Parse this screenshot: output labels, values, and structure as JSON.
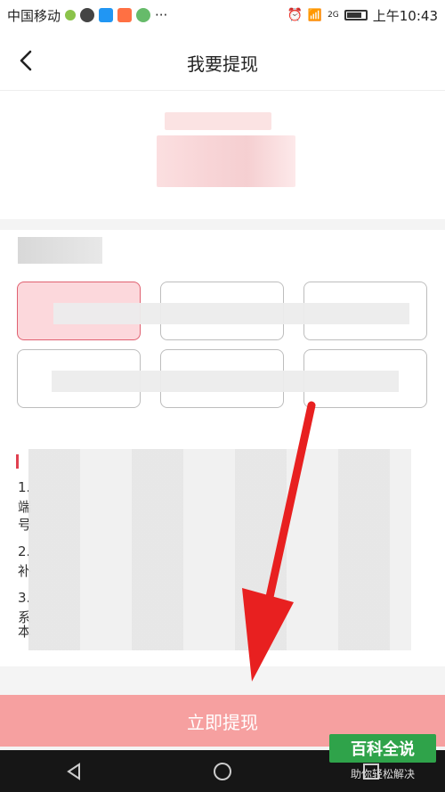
{
  "status_bar": {
    "carrier": "中国移动",
    "more": "···",
    "network": "2G",
    "time": "上午10:43"
  },
  "nav": {
    "title": "我要提现"
  },
  "amount_options": [
    "",
    "",
    "",
    "",
    "",
    ""
  ],
  "notes": {
    "lines": [
      "1.",
      "端",
      "号",
      "2.",
      "补",
      "3.",
      "系",
      "本"
    ]
  },
  "submit": {
    "label": "立即提现"
  },
  "watermark": {
    "title": "百科全说",
    "subtitle": "助你轻松解决"
  },
  "colors": {
    "submit_bg": "#f6a0a0",
    "selected_option": "#fcd8dc",
    "arrow": "#e82020"
  }
}
